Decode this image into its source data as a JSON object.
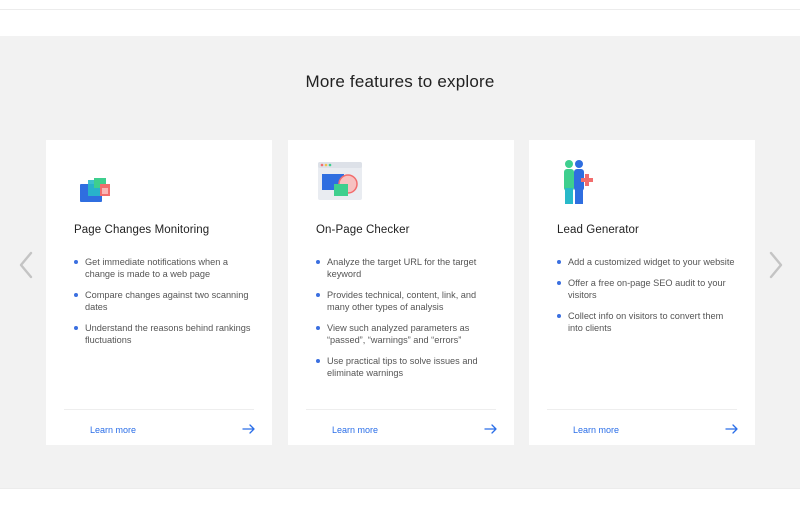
{
  "section": {
    "title": "More features to explore"
  },
  "carousel": {
    "prev_icon": "chevron-left-icon",
    "next_icon": "chevron-right-icon"
  },
  "cards": [
    {
      "icon": "page-changes-icon",
      "title": "Page Changes Monitoring",
      "bullets": [
        "Get immediate notifications when a change is made to a web page",
        "Compare changes against two scanning dates",
        "Understand the reasons behind rankings fluctuations"
      ],
      "link": "Learn more"
    },
    {
      "icon": "browser-checker-icon",
      "title": "On-Page Checker",
      "bullets": [
        "Analyze the target URL for the target keyword",
        "Provides technical, content, link, and many other types of analysis",
        "View such analyzed parameters as “passed”, “warnings” and “errors”",
        "Use practical tips to solve issues and eliminate warnings"
      ],
      "link": "Learn more"
    },
    {
      "icon": "lead-people-icon",
      "title": "Lead Generator",
      "bullets": [
        "Add a customized widget to your website",
        "Offer a free on-page SEO audit to your visitors",
        "Collect info on visitors to convert them into clients"
      ],
      "link": "Learn more"
    }
  ],
  "colors": {
    "accent": "#2a6ee8",
    "bullet": "#3b6fe0",
    "section_bg": "#f2f2f2",
    "icon_blue": "#2f6ee0",
    "icon_green": "#3ecf8e",
    "icon_red": "#f26d6d",
    "icon_teal": "#28b9c9"
  }
}
